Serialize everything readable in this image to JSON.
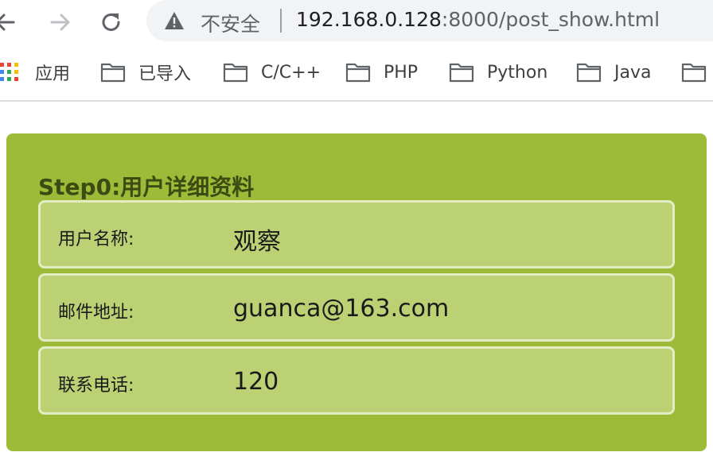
{
  "browser": {
    "security_label": "不安全",
    "url_host": "192.168.0.128",
    "url_rest": ":8000/post_show.html"
  },
  "bookmarks": [
    {
      "label": "应用",
      "icon": "apps-grid-icon"
    },
    {
      "label": "已导入",
      "icon": "folder-icon"
    },
    {
      "label": "C/C++",
      "icon": "folder-icon"
    },
    {
      "label": "PHP",
      "icon": "folder-icon"
    },
    {
      "label": "Python",
      "icon": "folder-icon"
    },
    {
      "label": "Java",
      "icon": "folder-icon"
    },
    {
      "label": "",
      "icon": "folder-icon"
    }
  ],
  "panel": {
    "title": "Step0:用户详细资料",
    "rows": [
      {
        "label": "用户名称:",
        "value": "观察"
      },
      {
        "label": "邮件地址:",
        "value": "guanca@163.com"
      },
      {
        "label": "联系电话:",
        "value": "120"
      }
    ]
  },
  "colors": {
    "panel_bg": "#9dbb38",
    "row_bg": "#bcd174",
    "row_border": "#e4ecc4",
    "title_text": "#3d4a12"
  }
}
